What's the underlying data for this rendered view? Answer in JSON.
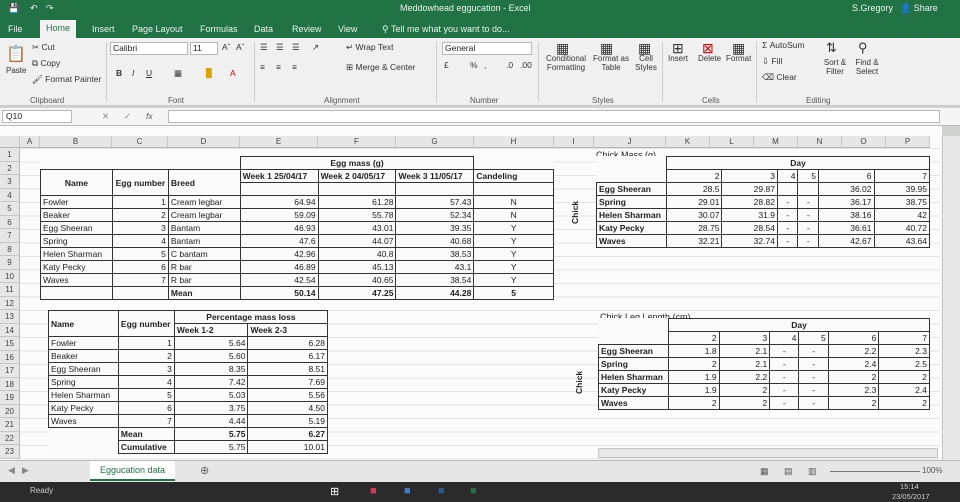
{
  "titlebar": {
    "file_title": "Meddowhead eggucation - Excel",
    "user": "S.Gregory",
    "share": "Share"
  },
  "tabs": [
    "File",
    "Home",
    "Insert",
    "Page Layout",
    "Formulas",
    "Data",
    "Review",
    "View"
  ],
  "tell_me": "Tell me what you want to do...",
  "ribbon": {
    "paste": "Paste",
    "cut": "Cut",
    "copy": "Copy",
    "format_painter": "Format Painter",
    "font_name": "Calibri",
    "font_size": "11",
    "wrap_text": "Wrap Text",
    "merge_center": "Merge & Center",
    "number_format": "General",
    "conditional_formatting": "Conditional Formatting",
    "format_as_table": "Format as Table",
    "cell_styles": "Cell Styles",
    "insert": "Insert",
    "delete": "Delete",
    "format": "Format",
    "autosum": "AutoSum",
    "fill": "Fill",
    "clear": "Clear",
    "sort_filter": "Sort & Filter",
    "find_select": "Find & Select",
    "groups": {
      "clipboard": "Clipboard",
      "font": "Font",
      "alignment": "Alignment",
      "number": "Number",
      "styles": "Styles",
      "cells": "Cells",
      "editing": "Editing"
    }
  },
  "name_box": "Q10",
  "columns": [
    "A",
    "B",
    "C",
    "D",
    "E",
    "F",
    "G",
    "H",
    "I",
    "J",
    "K",
    "L",
    "M",
    "N",
    "O",
    "P"
  ],
  "rows": [
    "1",
    "2",
    "3",
    "4",
    "5",
    "6",
    "7",
    "8",
    "9",
    "10",
    "11",
    "12",
    "13",
    "14",
    "15",
    "16",
    "17",
    "18",
    "19",
    "20",
    "21",
    "22",
    "23"
  ],
  "egg_table": {
    "title": "Egg mass (g)",
    "headers": [
      "Name",
      "Egg number",
      "Breed",
      "Week 1 25/04/17",
      "Week 2 04/05/17",
      "Week 3 11/05/17",
      "Candeling"
    ],
    "rows": [
      [
        "Fowler",
        "1",
        "Cream legbar",
        "64.94",
        "61.28",
        "57.43",
        "N"
      ],
      [
        "Beaker",
        "2",
        "Cream legbar",
        "59.09",
        "55.78",
        "52.34",
        "N"
      ],
      [
        "Egg Sheeran",
        "3",
        "Bantam",
        "46.93",
        "43.01",
        "39.35",
        "Y"
      ],
      [
        "Spring",
        "4",
        "Bantam",
        "47.6",
        "44.07",
        "40.68",
        "Y"
      ],
      [
        "Helen Sharman",
        "5",
        "C bantam",
        "42.96",
        "40.8",
        "38.53",
        "Y"
      ],
      [
        "Katy Pecky",
        "6",
        "R bar",
        "46.89",
        "45.13",
        "43.1",
        "Y"
      ],
      [
        "Waves",
        "7",
        "R bar",
        "42.54",
        "40.65",
        "38.54",
        "Y"
      ]
    ],
    "mean": [
      "Mean",
      "50.14",
      "47.25",
      "44.28",
      "5"
    ]
  },
  "loss_table": {
    "title": "Percentage mass loss",
    "headers": [
      "Name",
      "Egg number",
      "Week 1-2",
      "Week 2-3"
    ],
    "rows": [
      [
        "Fowler",
        "1",
        "5.64",
        "6.28"
      ],
      [
        "Beaker",
        "2",
        "5.60",
        "6.17"
      ],
      [
        "Egg Sheeran",
        "3",
        "8.35",
        "8.51"
      ],
      [
        "Spring",
        "4",
        "7.42",
        "7.69"
      ],
      [
        "Helen Sharman",
        "5",
        "5.03",
        "5.56"
      ],
      [
        "Katy Pecky",
        "6",
        "3.75",
        "4.50"
      ],
      [
        "Waves",
        "7",
        "4.44",
        "5.19"
      ]
    ],
    "mean": [
      "Mean",
      "5.75",
      "6.27"
    ],
    "cumulative": [
      "Cumulative",
      "5.75",
      "10.01"
    ]
  },
  "chick_mass": {
    "caption": "Chick Mass (g)",
    "side_label": "Chick",
    "day_label": "Day",
    "days": [
      "2",
      "3",
      "4",
      "5",
      "6",
      "7"
    ],
    "rows": [
      [
        "Egg Sheeran",
        "28.5",
        "29.87",
        "",
        "",
        "36.02",
        "39.95"
      ],
      [
        "Spring",
        "29.01",
        "28.82",
        "-",
        "-",
        "36.17",
        "38.75"
      ],
      [
        "Helen Sharman",
        "30.07",
        "31.9",
        "-",
        "-",
        "38.16",
        "42"
      ],
      [
        "Katy Pecky",
        "28.75",
        "28.54",
        "-",
        "-",
        "36.61",
        "40.72"
      ],
      [
        "Waves",
        "32.21",
        "32.74",
        "-",
        "-",
        "42.67",
        "43.64"
      ]
    ]
  },
  "chick_leg": {
    "caption": "Chick Leg Length (cm)",
    "side_label": "Chick",
    "day_label": "Day",
    "days": [
      "2",
      "3",
      "4",
      "5",
      "6",
      "7"
    ],
    "rows": [
      [
        "Egg Sheeran",
        "1.8",
        "2.1",
        "-",
        "-",
        "2.2",
        "2.3"
      ],
      [
        "Spring",
        "2",
        "2.1",
        "-",
        "-",
        "2.4",
        "2.5"
      ],
      [
        "Helen Sharman",
        "1.9",
        "2.2",
        "-",
        "-",
        "2",
        "2"
      ],
      [
        "Katy Pecky",
        "1.9",
        "2",
        "-",
        "-",
        "2.3",
        "2.4"
      ],
      [
        "Waves",
        "2",
        "2",
        "-",
        "-",
        "2",
        "2"
      ]
    ]
  },
  "sheet_tab": "Eggucation data",
  "status": {
    "ready": "Ready",
    "zoom": "100%",
    "time": "15:14",
    "date": "23/05/2017"
  }
}
